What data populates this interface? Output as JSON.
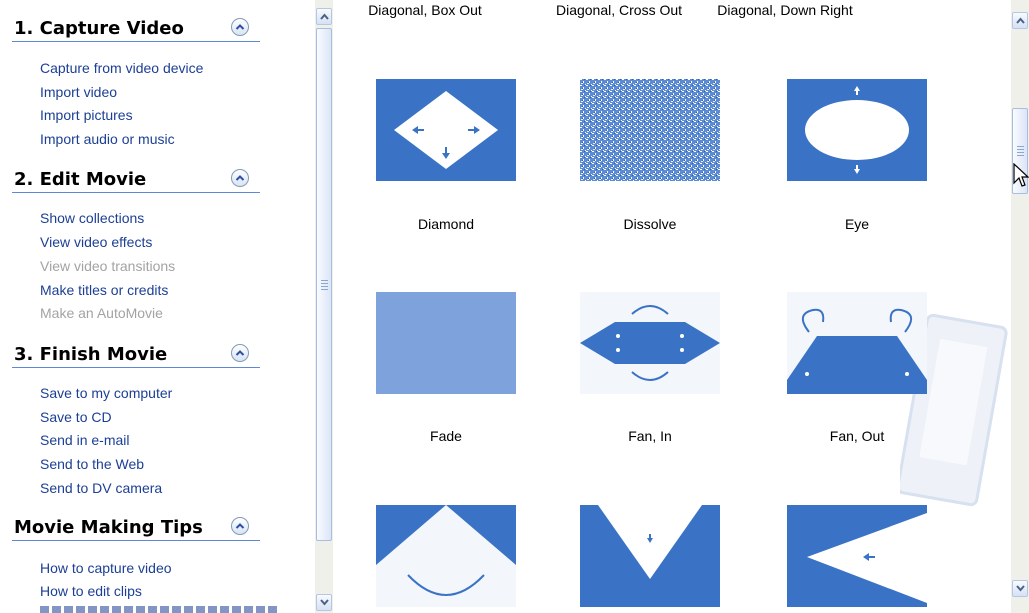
{
  "task_pane": {
    "sections": [
      {
        "title": "1. Capture Video",
        "links": [
          {
            "label": "Capture from video device",
            "enabled": true
          },
          {
            "label": "Import video",
            "enabled": true
          },
          {
            "label": "Import pictures",
            "enabled": true
          },
          {
            "label": "Import audio or music",
            "enabled": true
          }
        ]
      },
      {
        "title": "2. Edit Movie",
        "links": [
          {
            "label": "Show collections",
            "enabled": true
          },
          {
            "label": "View video effects",
            "enabled": true
          },
          {
            "label": "View video transitions",
            "enabled": false
          },
          {
            "label": "Make titles or credits",
            "enabled": true
          },
          {
            "label": "Make an AutoMovie",
            "enabled": false
          }
        ]
      },
      {
        "title": "3. Finish Movie",
        "links": [
          {
            "label": "Save to my computer",
            "enabled": true
          },
          {
            "label": "Save to CD",
            "enabled": true
          },
          {
            "label": "Send in e-mail",
            "enabled": true
          },
          {
            "label": "Send to the Web",
            "enabled": true
          },
          {
            "label": "Send to DV camera",
            "enabled": true
          }
        ]
      },
      {
        "title": "Movie Making Tips",
        "links": [
          {
            "label": "How to capture video",
            "enabled": true
          },
          {
            "label": "How to edit clips",
            "enabled": true
          }
        ]
      }
    ]
  },
  "transitions": {
    "top_row_labels": [
      "Diagonal, Box Out",
      "Diagonal, Cross Out",
      "Diagonal, Down Right"
    ],
    "items": [
      {
        "label": "Diamond",
        "icon": "diamond-transition-icon"
      },
      {
        "label": "Dissolve",
        "icon": "dissolve-transition-icon"
      },
      {
        "label": "Eye",
        "icon": "eye-transition-icon"
      },
      {
        "label": "Fade",
        "icon": "fade-transition-icon"
      },
      {
        "label": "Fan, In",
        "icon": "fan-in-transition-icon"
      },
      {
        "label": "Fan, Out",
        "icon": "fan-out-transition-icon"
      },
      {
        "label": "",
        "icon": "bow-tie-transition-icon"
      },
      {
        "label": "",
        "icon": "v-down-transition-icon"
      },
      {
        "label": "",
        "icon": "chevron-left-transition-icon"
      }
    ]
  },
  "colors": {
    "tile_blue": "#3a73c6",
    "link_blue": "#1c3f95",
    "disabled_gray": "#a3a3a3",
    "header_rule": "#5f88d4"
  }
}
